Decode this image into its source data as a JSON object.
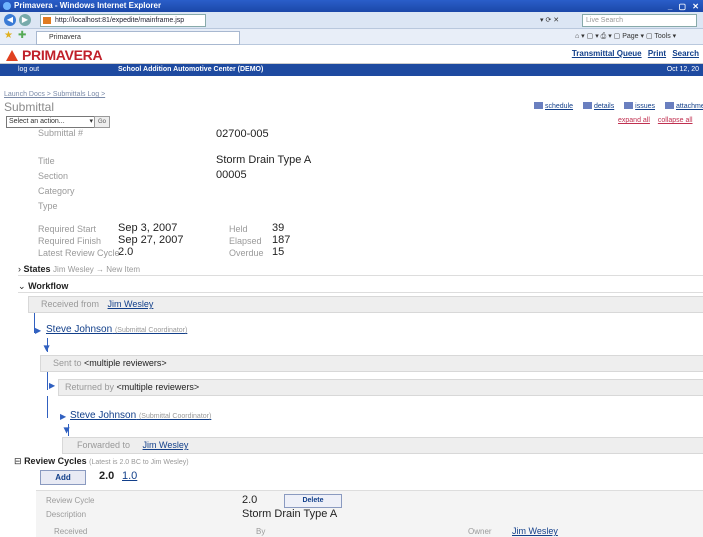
{
  "window": {
    "title": "Primavera - Windows Internet Explorer",
    "url": "http://localhost:81/expedite/mainframe.jsp",
    "search_placeholder": "Live Search",
    "tab_label": "Primavera"
  },
  "browser_tools": {
    "cmd": "⌂ ▾ ▢ ▾ ⎙ ▾ ▢ Page ▾ ▢ Tools ▾"
  },
  "brand": {
    "name": "PRIMAVERA",
    "links": [
      "Transmittal Queue",
      "Print",
      "Search"
    ]
  },
  "context": {
    "logout": "log out",
    "project": "School Addition Automotive Center (DEMO)",
    "date": "Oct 12, 20"
  },
  "breadcrumb": "Launch Docs > Submittals Log >",
  "page_title": "Submittal",
  "view_links": [
    "schedule",
    "details",
    "issues",
    "attachments"
  ],
  "action_select": "Select an action...",
  "go_label": "Go",
  "expand_links": [
    "expand all",
    "collapse all"
  ],
  "fields": {
    "submittal_no_label": "Submittal #",
    "submittal_no": "02700-005",
    "title_label": "Title",
    "title": "Storm Drain Type A",
    "section_label": "Section",
    "section": "00005",
    "category_label": "Category",
    "type_label": "Type"
  },
  "dates": {
    "req_start_label": "Required Start",
    "req_start": "Sep 3, 2007",
    "req_finish_label": "Required Finish",
    "req_finish": "Sep 27, 2007",
    "latest_cycle_label": "Latest Review Cycle",
    "latest_cycle": "2.0",
    "held_label": "Held",
    "held": "39",
    "elapsed_label": "Elapsed",
    "elapsed": "187",
    "overdue_label": "Overdue",
    "overdue": "15"
  },
  "status": {
    "label": "States",
    "detail": "Jim Wesley → New Item"
  },
  "workflow": {
    "label": "Workflow",
    "received_label": "Received from",
    "received_name": "Jim Wesley",
    "actor1": "Steve Johnson",
    "actor1_role": "(Submittal Coordinator)",
    "sent_label": "Sent to",
    "sent_to": "<multiple reviewers>",
    "returned_label": "Returned by",
    "returned_by": "<multiple reviewers>",
    "actor2": "Steve Johnson",
    "actor2_role": "(Submittal Coordinator)",
    "forwarded_label": "Forwarded to",
    "forwarded_name": "Jim Wesley"
  },
  "review_cycles": {
    "label": "Review Cycles",
    "sub": "(Latest is 2.0 BC to Jim Wesley)",
    "add_label": "Add",
    "current": "2.0",
    "other": "1.0",
    "cycle_label": "Review Cycle",
    "cycle": "2.0",
    "delete_label": "Delete",
    "desc_label": "Description",
    "desc": "Storm Drain Type A",
    "received_label": "Received",
    "by_label": "By",
    "owner_label": "Owner",
    "owner": "Jim Wesley"
  }
}
